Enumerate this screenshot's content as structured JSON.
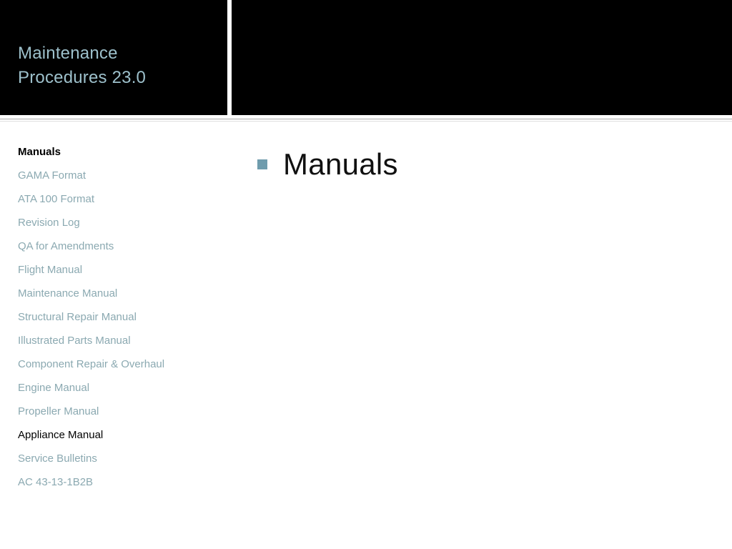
{
  "header": {
    "deck_title": "Maintenance\nProcedures 23.0",
    "title_color": "#9dc0cb",
    "background_color": "#000000"
  },
  "sidebar": {
    "link_color": "#8ba9b1",
    "items": [
      {
        "label": "Manuals",
        "state": "current"
      },
      {
        "label": "GAMA Format",
        "state": "normal"
      },
      {
        "label": "ATA 100 Format",
        "state": "normal"
      },
      {
        "label": "Revision Log",
        "state": "normal"
      },
      {
        "label": "QA for Amendments",
        "state": "normal"
      },
      {
        "label": "Flight Manual",
        "state": "normal"
      },
      {
        "label": "Maintenance Manual",
        "state": "normal"
      },
      {
        "label": "Structural Repair Manual",
        "state": "normal"
      },
      {
        "label": "Illustrated Parts Manual",
        "state": "normal"
      },
      {
        "label": "Component Repair & Overhaul",
        "state": "normal"
      },
      {
        "label": "Engine Manual",
        "state": "normal"
      },
      {
        "label": "Propeller Manual",
        "state": "normal"
      },
      {
        "label": "Appliance Manual",
        "state": "active"
      },
      {
        "label": "Service Bulletins",
        "state": "normal"
      },
      {
        "label": "AC 43-13-1B2B",
        "state": "normal"
      }
    ]
  },
  "main": {
    "bullets": [
      {
        "text": "Manuals",
        "marker": "square-bullet-icon",
        "marker_color": "#6f9cad"
      }
    ]
  }
}
